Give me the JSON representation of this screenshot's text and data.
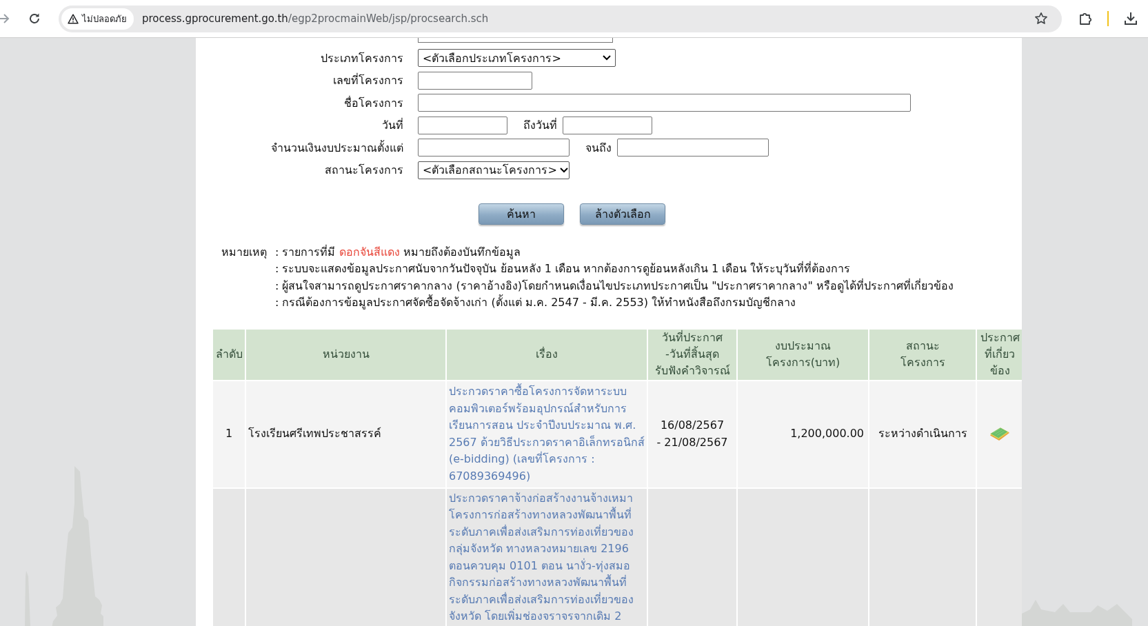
{
  "browser": {
    "security_label": "ไม่ปลอดภัย",
    "url_host": "process.gprocurement.go.th",
    "url_path": "/egp2procmainWeb/jsp/procsearch.sch"
  },
  "search_form": {
    "fields": [
      {
        "kind": "cut_select"
      },
      {
        "kind": "select_wide",
        "label": "ประเภทโครงการ",
        "value": "<ตัวเลือกประเภทโครงการ>"
      },
      {
        "kind": "text_short",
        "label": "เลขที่โครงการ"
      },
      {
        "kind": "text_long",
        "label": "ชื่อโครงการ"
      },
      {
        "kind": "date_range",
        "label": "วันที่",
        "to_label": "ถึงวันที่"
      },
      {
        "kind": "amount_range",
        "label": "จำนวนเงินงบประมาณตั้งแต่",
        "to_label": "จนถึง"
      },
      {
        "kind": "select",
        "label": "สถานะโครงการ",
        "value": "<ตัวเลือกสถานะโครงการ>"
      }
    ],
    "buttons": [
      "ค้นหา",
      "ล้างตัวเลือก"
    ]
  },
  "notes": {
    "label": "หมายเหตุ",
    "lines": [
      {
        "parts": [
          {
            "text": ": รายการที่มี ",
            "highlighted": false
          },
          {
            "text": "ดอกจันสีแดง",
            "highlighted": true
          },
          {
            "text": " หมายถึงต้องบันทึกข้อมูล",
            "highlighted": false
          }
        ]
      },
      {
        "parts": [
          {
            "text": ": ระบบจะแสดงข้อมูลประกาศนับจากวันปัจจุบัน ย้อนหลัง 1 เดือน หากต้องการดูย้อนหลังเกิน 1 เดือน ให้ระบุวันที่ที่ต้องการ",
            "highlighted": false
          }
        ]
      },
      {
        "parts": [
          {
            "text": ": ผู้สนใจสามารถดูประกาศราคากลาง (ราคาอ้างอิง)โดยกำหนดเงื่อนไขประเภทประกาศเป็น \"ประกาศราคากลาง\" หรือดูได้ที่ประกาศที่เกี่ยวข้อง",
            "highlighted": false
          }
        ]
      },
      {
        "parts": [
          {
            "text": ": กรณีต้องการข้อมูลประกาศจัดซื้อจัดจ้างเก่า (ตั้งแต่ ม.ค. 2547 - มี.ค. 2553) ให้ทำหนังสือถึงกรมบัญชีกลาง",
            "highlighted": false
          }
        ]
      }
    ]
  },
  "table": {
    "columns": [
      "ลำดับ",
      "หน่วยงาน",
      "เรื่อง",
      "วันที่ประกาศ\n-วันที่สิ้นสุด\nรับฟังคำวิจารณ์",
      "งบประมาณ\nโครงการ(บาท)",
      "สถานะ\nโครงการ",
      "ประกาศ\nที่เกี่ยว\nข้อง"
    ],
    "rows": [
      {
        "index": "1",
        "agency": "โรงเรียนศรีเทพประชาสรรค์",
        "title": "ประกวดราคาซื้อโครงการจัดหาระบบคอมพิวเตอร์พร้อมอุปกรณ์สำหรับการเรียนการสอน ประจำปีงบประมาณ พ.ศ. 2567 ด้วยวิธีประกวดราคาอิเล็กทรอนิกส์ (e-bidding) (เลขที่โครงการ : 67089369496)",
        "dates": "16/08/2567\n- 21/08/2567",
        "budget": "1,200,000.00",
        "status": "ระหว่างดำเนินการ",
        "has_announcement": true
      },
      {
        "title": "ประกวดราคาจ้างก่อสร้างงานจ้างเหมาโครงการก่อสร้างทางหลวงพัฒนาพื้นที่ระดับภาคเพื่อส่งเสริมการท่องเที่ยวของกลุ่มจังหวัด ทางหลวงหมายเลข 2196 ตอนควบคุม 0101 ตอน นางั่ว-ทุ่งสมอ กิจกรรมก่อสร้างทางหลวงพัฒนาพื้นที่ระดับภาคเพื่อส่งเสริมการท่องเที่ยวของจังหวัด โดยเพิ่มช่องจราจรจากเดิม 2",
        "has_announcement": false
      }
    ]
  }
}
